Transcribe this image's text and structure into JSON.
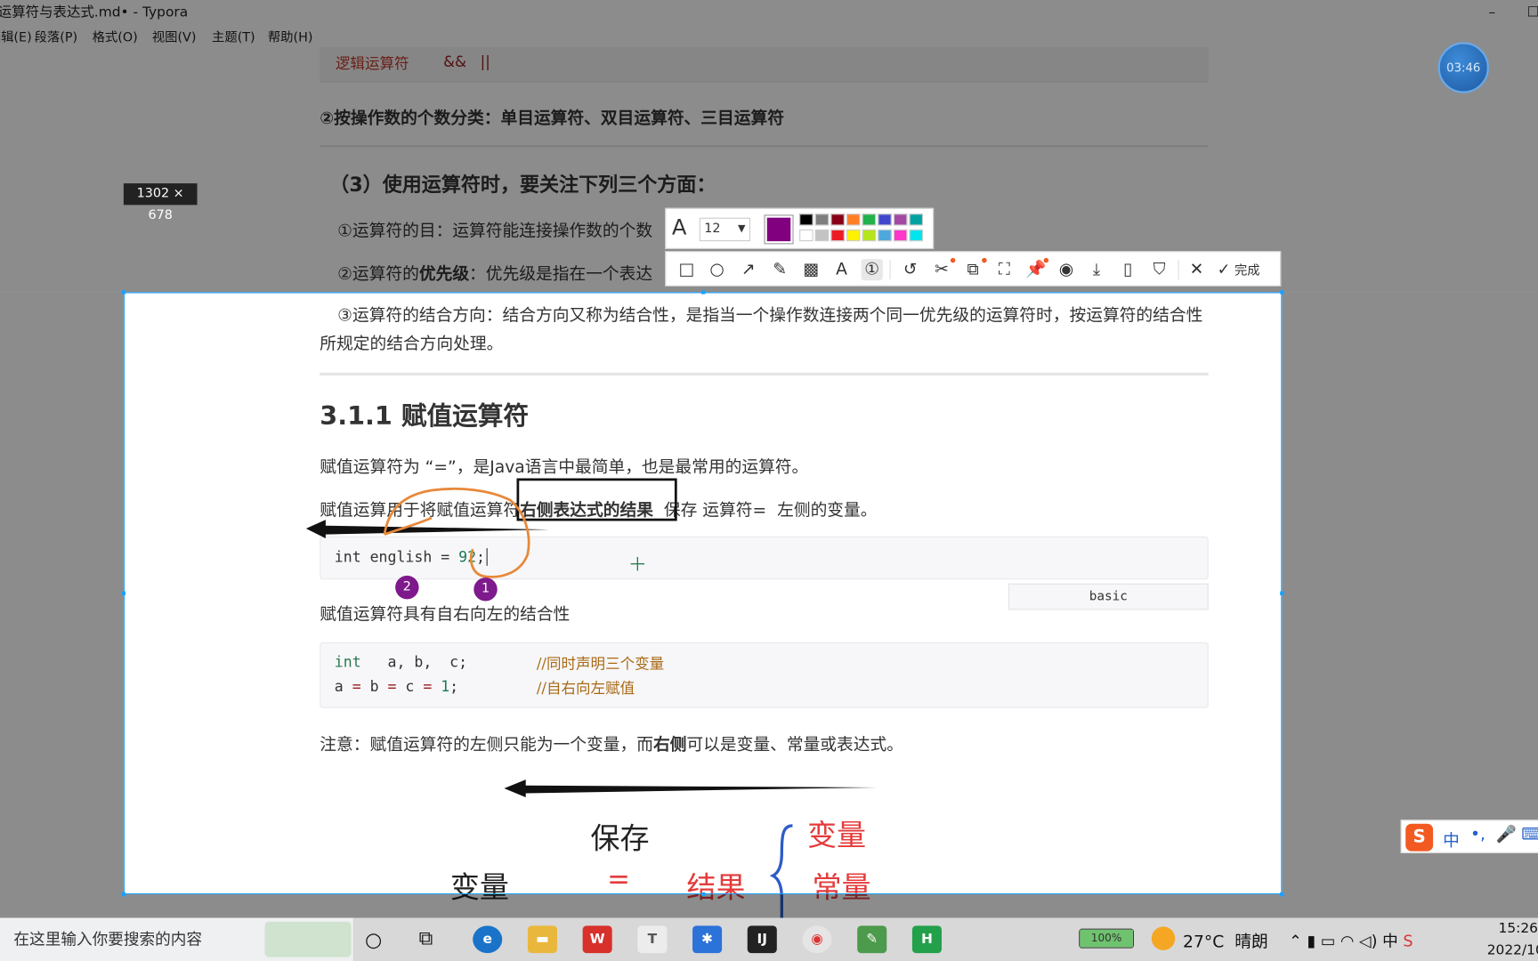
{
  "window": {
    "title": "运算符与表达式.md• - Typora",
    "minimize_glyph": "–",
    "maximize_glyph": "☐"
  },
  "menu": [
    "编辑(E)",
    "段落(P)",
    "格式(O)",
    "视图(V)",
    "主题(T)",
    "帮助(H)"
  ],
  "doc": {
    "logic_row": {
      "label": "逻辑运算符",
      "ops": "&&   ||"
    },
    "para_count_class": "②按操作数的个数分类：单目运算符、双目运算符、三目运算符",
    "heading_3": "（3）使用运算符时，要关注下列三个方面：",
    "item_1": "①运算符的目：运算符能连接操作数的个数",
    "item_2_prefix": "②运算符的",
    "item_2_bold": "优先级",
    "item_2_suffix": "：优先级是指在一个表达",
    "item_3": "③运算符的结合方向：结合方向又称为结合性，是指当一个操作数连接两个同一优先级的运算符时，按运算符的结合性所规定的结合方向处理。",
    "section_title": "3.1.1 赋值运算符",
    "p_intro": "赋值运算符为 “=”，是Java语言中最简单，也是最常用的运算符。",
    "p_use_prefix": "赋值运算用于将赋值运算符",
    "p_use_bold": "右侧表达式的结果",
    "p_use_suffix": "  保存 运算符=  左侧的变量。",
    "code1": {
      "kw": "int",
      "name": " english = ",
      "num": "92",
      "end": ";"
    },
    "code_lang": "basic",
    "p_assoc": "赋值运算符具有自右向左的结合性",
    "code2": {
      "l1_kw": "int",
      "l1_rest": "   a, b,  c;",
      "l1_cm": "//同时声明三个变量",
      "l2_a": "a",
      "l2_b": " b ",
      "l2_c": " c ",
      "l2_num": "1",
      "l2_cm": "//自右向左赋值",
      "eq": "="
    },
    "p_note_prefix": "注意：赋值运算符的左侧只能为一个变量，而",
    "p_note_bold": "右侧",
    "p_note_suffix": "可以是变量、常量或表达式。"
  },
  "annotations": {
    "marker_1": "1",
    "marker_2": "2",
    "hw_save": "保存",
    "hw_var_left": "变量",
    "hw_eq": "=",
    "hw_result": "结果",
    "hw_var_right": "变量",
    "hw_const": "常量"
  },
  "screenshot_tool": {
    "size_label": "1302 × 678",
    "font_size": "12",
    "selected_color": "#800080",
    "palette": [
      "#000000",
      "#7f7f7f",
      "#880015",
      "#ff7f27",
      "#22b14c",
      "#3f48cc",
      "#a349a4",
      "#00a2a2",
      "#ffffff",
      "#c3c3c3",
      "#ed1c24",
      "#fff200",
      "#b5e61d",
      "#4ea8de",
      "#ff36c9",
      "#00e5ee"
    ],
    "done_label": "完成"
  },
  "timer": {
    "text": "03:46"
  },
  "ime": {
    "label": "中"
  },
  "taskbar": {
    "search_placeholder": "在这里输入你要搜索的内容",
    "battery": "100%",
    "weather": "27°C  晴朗",
    "time": "15:26",
    "date": "2022/10"
  }
}
